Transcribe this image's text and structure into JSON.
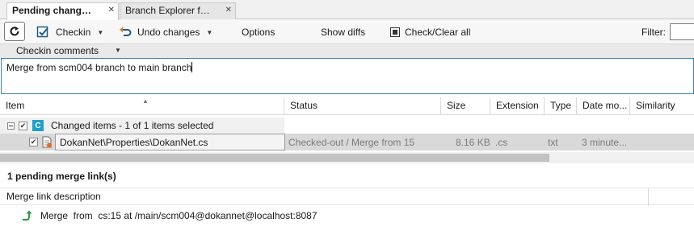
{
  "tabs": [
    {
      "label": "Pending changes",
      "display": "Pending chang…",
      "active": true
    },
    {
      "label": "Branch Explorer",
      "display": "Branch Explorer f…",
      "active": false
    }
  ],
  "toolbar": {
    "checkin_label": "Checkin",
    "undo_label": "Undo changes",
    "options_label": "Options",
    "show_diffs_label": "Show diffs",
    "check_clear_label": "Check/Clear all",
    "filter_label": "Filter:",
    "filter_value": ""
  },
  "comments": {
    "header_label": "Checkin comments",
    "text": "Merge from scm004 branch to main branch"
  },
  "grid": {
    "columns": [
      "Item",
      "Status",
      "Size",
      "Extension",
      "Type",
      "Date mo...",
      "Similarity"
    ],
    "group": {
      "label": "Changed items - 1 of 1 items selected"
    },
    "rows": [
      {
        "item": "DokanNet\\Properties\\DokanNet.cs",
        "status": "Checked-out / Merge from 15",
        "size": "8.16 KB",
        "extension": ".cs",
        "type": "txt",
        "date": "3 minute..."
      }
    ]
  },
  "merge_links": {
    "pending_label": "1 pending merge link(s)",
    "header_label": "Merge link description",
    "items": [
      {
        "text": "Merge  from  cs:15 at /main/scm004@dokannet@localhost:8087"
      }
    ]
  },
  "colors": {
    "accent": "#3c7fb1",
    "changed_icon": "#1fa0c8",
    "merge_arrow": "#2a9a3c"
  }
}
